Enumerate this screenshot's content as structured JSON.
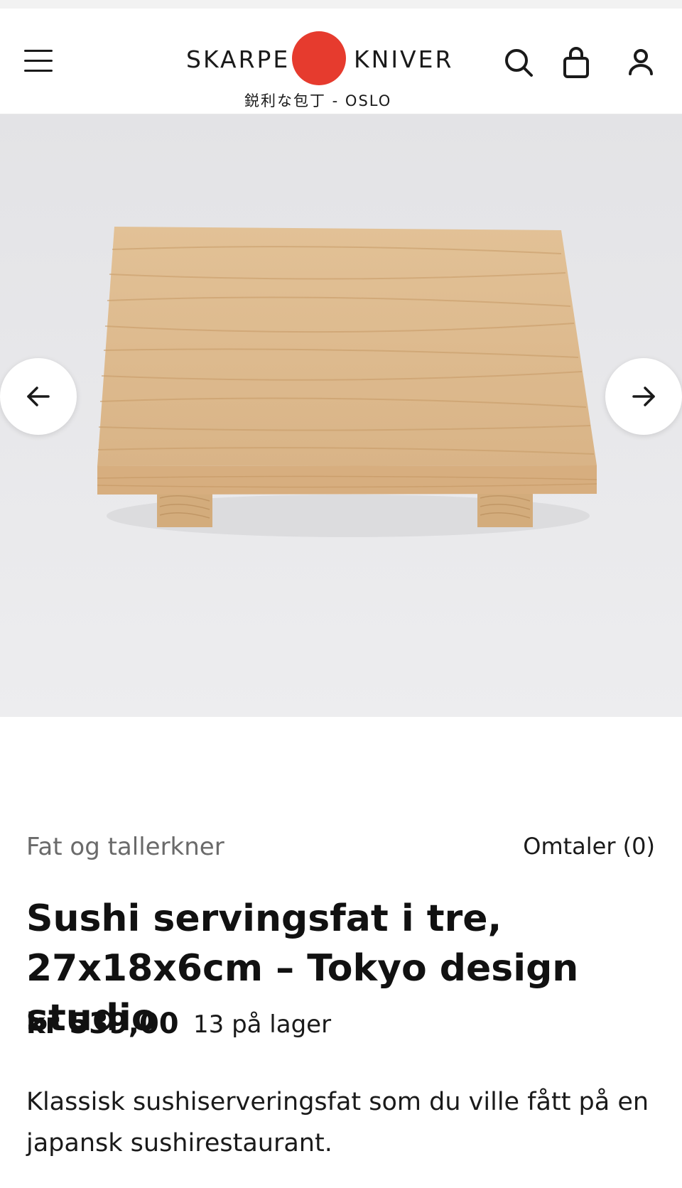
{
  "header": {
    "logo_left": "SKARPE",
    "logo_right": "KNIVER",
    "logo_sub": "鋭利な包丁 - OSLO",
    "brand_red": "#e63b2e",
    "icons": [
      "menu-icon",
      "search-icon",
      "bag-icon",
      "user-icon"
    ]
  },
  "gallery": {
    "prev_icon": "arrow-left-icon",
    "next_icon": "arrow-right-icon",
    "background_color": "#e9e9eb",
    "wood_color": "#dcb98d"
  },
  "product": {
    "category": "Fat og tallerkner",
    "reviews": "Omtaler (0)",
    "title": "Sushi servingsfat i tre, 27x18x6cm – Tokyo design studio",
    "price": "kr 539,00",
    "stock": "13 på lager",
    "description": "Klassisk sushiserveringsfat som du ville fått på en japansk sushirestaurant."
  }
}
